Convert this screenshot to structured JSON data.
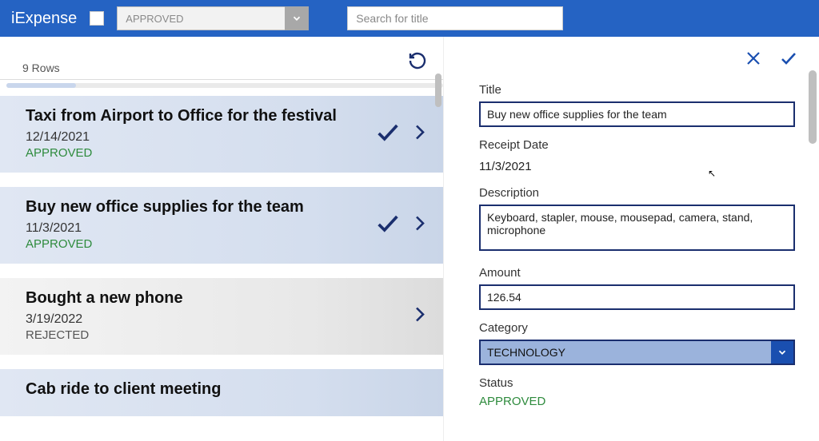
{
  "header": {
    "app_title": "iExpense",
    "status_filter": "APPROVED",
    "search_placeholder": "Search for title"
  },
  "left": {
    "row_count": "9 Rows"
  },
  "items": [
    {
      "title": "Taxi from Airport to Office for the festival",
      "date": "12/14/2021",
      "status": "APPROVED",
      "status_class": "approved",
      "tone": "alt",
      "show_check": true
    },
    {
      "title": "Buy new office supplies for the team",
      "date": "11/3/2021",
      "status": "APPROVED",
      "status_class": "approved",
      "tone": "alt",
      "show_check": true
    },
    {
      "title": "Bought a new phone",
      "date": "3/19/2022",
      "status": "REJECTED",
      "status_class": "rejected",
      "tone": "plain",
      "show_check": false
    },
    {
      "title": "Cab ride to client meeting",
      "date": "",
      "status": "",
      "status_class": "",
      "tone": "alt",
      "show_check": true
    }
  ],
  "detail": {
    "title_label": "Title",
    "title_value": "Buy new office supplies for the team",
    "date_label": "Receipt Date",
    "date_value": "11/3/2021",
    "description_label": "Description",
    "description_value": "Keyboard, stapler, mouse, mousepad, camera, stand, microphone",
    "amount_label": "Amount",
    "amount_value": "126.54",
    "category_label": "Category",
    "category_value": "TECHNOLOGY",
    "status_label": "Status",
    "status_value": "APPROVED"
  },
  "colors": {
    "brand": "#2563c3",
    "navy": "#1a2e6e",
    "approved": "#2e8b3d"
  }
}
